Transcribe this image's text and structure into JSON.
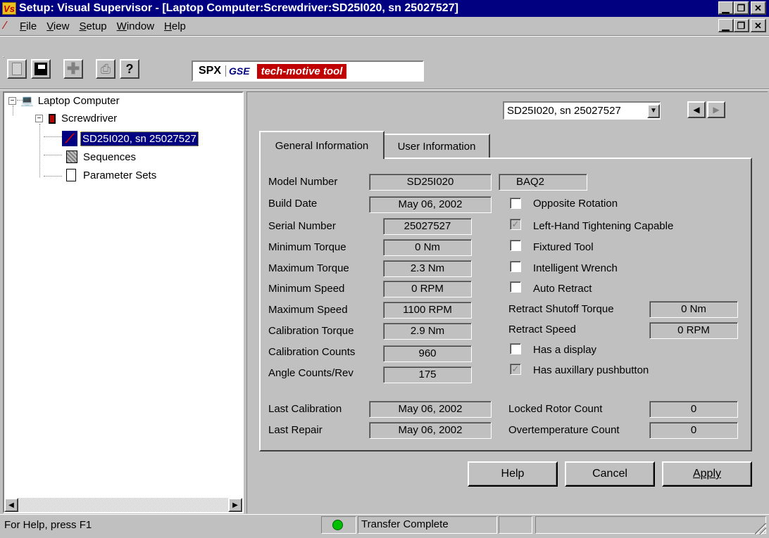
{
  "app": {
    "icon_text": "Vs",
    "title": "Setup: Visual Supervisor - [Laptop Computer:Screwdriver:SD25I020, sn 25027527]"
  },
  "menu": [
    "File",
    "View",
    "Setup",
    "Window",
    "Help"
  ],
  "toolbar": {
    "logo_spx": "SPX",
    "logo_gse": "GSE",
    "logo_tag": "tech-motive tool"
  },
  "tree": {
    "root": "Laptop Computer",
    "child": "Screwdriver",
    "selected": "SD25I020, sn 25027527",
    "sequences": "Sequences",
    "parameter_sets": "Parameter Sets"
  },
  "selector": {
    "value": "SD25I020, sn 25027527"
  },
  "tabs": {
    "general": "General Information",
    "user": "User Information"
  },
  "general": {
    "model_number_label": "Model Number",
    "model_number": "SD25I020",
    "model_code": "BAQ2",
    "build_date_label": "Build Date",
    "build_date": "May 06, 2002",
    "serial_number_label": "Serial Number",
    "serial_number": "25027527",
    "min_torque_label": "Minimum Torque",
    "min_torque": "0 Nm",
    "max_torque_label": "Maximum Torque",
    "max_torque": "2.3 Nm",
    "min_speed_label": "Minimum Speed",
    "min_speed": "0 RPM",
    "max_speed_label": "Maximum Speed",
    "max_speed": "1100 RPM",
    "cal_torque_label": "Calibration Torque",
    "cal_torque": "2.9 Nm",
    "cal_counts_label": "Calibration Counts",
    "cal_counts": "960",
    "angle_counts_label": "Angle Counts/Rev",
    "angle_counts": "175",
    "last_cal_label": "Last Calibration",
    "last_cal": "May 06, 2002",
    "last_repair_label": "Last Repair",
    "last_repair": "May 06, 2002",
    "opposite_rotation": "Opposite Rotation",
    "left_hand": "Left-Hand Tightening Capable",
    "fixtured_tool": "Fixtured Tool",
    "intelligent_wrench": "Intelligent Wrench",
    "auto_retract": "Auto Retract",
    "retract_shutoff_label": "Retract Shutoff Torque",
    "retract_shutoff": "0 Nm",
    "retract_speed_label": "Retract Speed",
    "retract_speed": "0 RPM",
    "has_display": "Has a display",
    "has_aux": "Has auxillary pushbutton",
    "locked_rotor_label": "Locked Rotor Count",
    "locked_rotor": "0",
    "overtemp_label": "Overtemperature Count",
    "overtemp": "0"
  },
  "buttons": {
    "help": "Help",
    "cancel": "Cancel",
    "apply": "Apply"
  },
  "status": {
    "help_text": "For Help, press F1",
    "transfer": "Transfer Complete",
    "led_color": "#00c000"
  }
}
